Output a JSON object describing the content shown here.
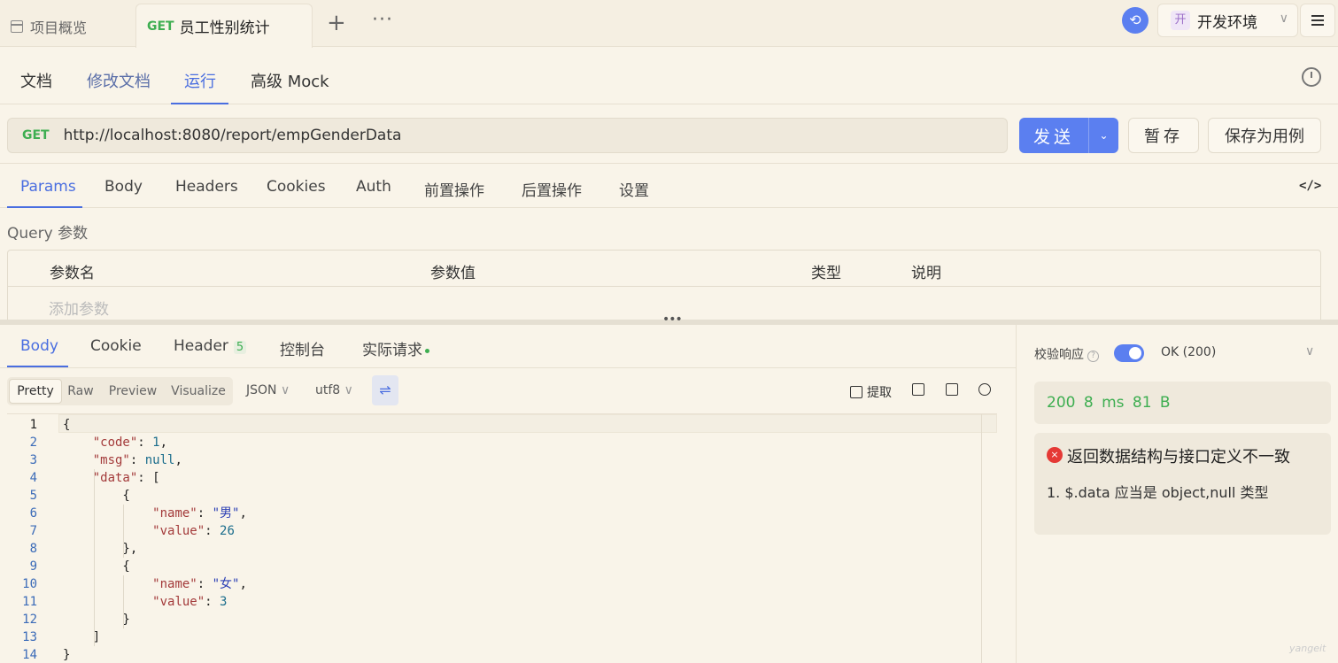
{
  "top_tabs": {
    "overview_label": "项目概览",
    "active_method": "GET",
    "active_title": "员工性别统计",
    "add_symbol": "+",
    "more_symbol": "···"
  },
  "environment": {
    "badge": "开",
    "name": "开发环境"
  },
  "doc_tabs": [
    "文档",
    "修改文档",
    "运行",
    "高级 Mock"
  ],
  "request": {
    "method": "GET",
    "url": "http://localhost:8080/report/empGenderData",
    "send_label": "发送",
    "temp_save_label": "暂存",
    "save_case_label": "保存为用例"
  },
  "param_tabs": [
    "Params",
    "Body",
    "Headers",
    "Cookies",
    "Auth",
    "前置操作",
    "后置操作",
    "设置"
  ],
  "query": {
    "label": "Query 参数",
    "columns": [
      "参数名",
      "参数值",
      "类型",
      "说明"
    ],
    "add_placeholder": "添加参数"
  },
  "response_tabs": {
    "body": "Body",
    "cookie": "Cookie",
    "header": "Header",
    "header_count": "5",
    "console": "控制台",
    "actual_request": "实际请求"
  },
  "view_modes": [
    "Pretty",
    "Raw",
    "Preview",
    "Visualize"
  ],
  "format": "JSON",
  "encoding": "utf8",
  "tools": {
    "extract": "提取"
  },
  "code_lines": [
    "{",
    "    \"code\": 1,",
    "    \"msg\": null,",
    "    \"data\": [",
    "        {",
    "            \"name\": \"男\",",
    "            \"value\": 26",
    "        },",
    "        {",
    "            \"name\": \"女\",",
    "            \"value\": 3",
    "        }",
    "    ]",
    "}"
  ],
  "validation": {
    "label": "校验响应",
    "status": "OK (200)",
    "stats": "200   8 ms   81 B",
    "error_title": "返回数据结构与接口定义不一致",
    "error_detail": "1. $.data 应当是 object,null 类型"
  },
  "watermark": "yangeit",
  "colors": {
    "accent": "#5b7ff0",
    "method_get": "#3eae51",
    "error": "#e53935",
    "background": "#f9f4e9"
  }
}
